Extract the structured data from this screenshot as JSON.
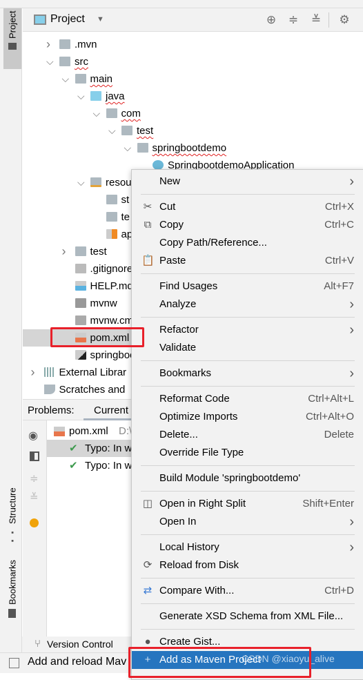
{
  "project_header": {
    "title": "Project",
    "icons": [
      "locate-icon",
      "expand-all-icon",
      "collapse-all-icon",
      "gear-icon"
    ]
  },
  "side_tabs": {
    "project": "Project",
    "structure": "Structure",
    "bookmarks": "Bookmarks"
  },
  "tree": [
    {
      "label": ".mvn",
      "indent": 0,
      "arrow": "right",
      "icon": "folder",
      "squiggle": false
    },
    {
      "label": "src",
      "indent": 0,
      "arrow": "down",
      "icon": "folder",
      "squiggle": true
    },
    {
      "label": "main",
      "indent": 1,
      "arrow": "down",
      "icon": "folder",
      "squiggle": true
    },
    {
      "label": "java",
      "indent": 2,
      "arrow": "down",
      "icon": "source-folder",
      "squiggle": true
    },
    {
      "label": "com",
      "indent": 3,
      "arrow": "down",
      "icon": "package",
      "squiggle": true
    },
    {
      "label": "test",
      "indent": 4,
      "arrow": "down",
      "icon": "package",
      "squiggle": true
    },
    {
      "label": "springbootdemo",
      "indent": 5,
      "arrow": "down",
      "icon": "package",
      "squiggle": true
    },
    {
      "label": "SpringbootdemoApplication",
      "indent": 6,
      "arrow": "",
      "icon": "spring-class",
      "squiggle": false
    },
    {
      "label": "resou",
      "indent": 2,
      "arrow": "down",
      "icon": "resources-folder",
      "squiggle": false
    },
    {
      "label": "st",
      "indent": 3,
      "arrow": "",
      "icon": "folder",
      "squiggle": false
    },
    {
      "label": "te",
      "indent": 3,
      "arrow": "",
      "icon": "folder",
      "squiggle": false
    },
    {
      "label": "ap",
      "indent": 3,
      "arrow": "",
      "icon": "properties-file",
      "squiggle": false
    },
    {
      "label": "test",
      "indent": 1,
      "arrow": "right",
      "icon": "folder",
      "squiggle": false
    },
    {
      "label": ".gitignore",
      "indent": 1,
      "arrow": "",
      "icon": "ignore-file",
      "squiggle": false
    },
    {
      "label": "HELP.md",
      "indent": 1,
      "arrow": "",
      "icon": "markdown-file",
      "squiggle": false
    },
    {
      "label": "mvnw",
      "indent": 1,
      "arrow": "",
      "icon": "shell-file",
      "squiggle": false
    },
    {
      "label": "mvnw.cmd",
      "indent": 1,
      "arrow": "",
      "icon": "text-file",
      "squiggle": false
    },
    {
      "label": "pom.xml",
      "indent": 1,
      "arrow": "",
      "icon": "xml-file",
      "squiggle": false,
      "selected": true
    },
    {
      "label": "springboot",
      "indent": 1,
      "arrow": "",
      "icon": "iml-file",
      "squiggle": false
    },
    {
      "label": "External Librar",
      "indent": -1,
      "arrow": "right",
      "icon": "libraries",
      "squiggle": false
    },
    {
      "label": "Scratches and",
      "indent": -1,
      "arrow": "",
      "icon": "scratches",
      "squiggle": false
    }
  ],
  "problems": {
    "label": "Problems:",
    "tab": "Current",
    "file": "pom.xml",
    "path": "D:\\",
    "items": [
      "Typo: In w",
      "Typo: In w"
    ]
  },
  "bottom": {
    "version_control": "Version Control",
    "status": "Add and reload Mav"
  },
  "menu": [
    {
      "label": "New",
      "submenu": true
    },
    {
      "sep": true
    },
    {
      "label": "Cut",
      "u": "t",
      "shortcut": "Ctrl+X",
      "icon": "scissors-icon",
      "glyph": "✂"
    },
    {
      "label": "Copy",
      "u": "C",
      "shortcut": "Ctrl+C",
      "icon": "copy-icon",
      "glyph": "⧉"
    },
    {
      "label": "Copy Path/Reference..."
    },
    {
      "label": "Paste",
      "u": "P",
      "shortcut": "Ctrl+V",
      "icon": "clipboard-icon",
      "glyph": "📋"
    },
    {
      "sep": true
    },
    {
      "label": "Find Usages",
      "u": "U",
      "shortcut": "Alt+F7"
    },
    {
      "label": "Analyze",
      "u": "z",
      "submenu": true
    },
    {
      "sep": true
    },
    {
      "label": "Refactor",
      "u": "R",
      "submenu": true
    },
    {
      "label": "Validate",
      "u": "V"
    },
    {
      "sep": true
    },
    {
      "label": "Bookmarks",
      "submenu": true
    },
    {
      "sep": true
    },
    {
      "label": "Reformat Code",
      "u": "R",
      "shortcut": "Ctrl+Alt+L"
    },
    {
      "label": "Optimize Imports",
      "u": "z",
      "shortcut": "Ctrl+Alt+O"
    },
    {
      "label": "Delete...",
      "u": "D",
      "shortcut": "Delete"
    },
    {
      "label": "Override File Type"
    },
    {
      "sep": true
    },
    {
      "label": "Build Module 'springbootdemo'",
      "u": "M"
    },
    {
      "sep": true
    },
    {
      "label": "Open in Right Split",
      "shortcut": "Shift+Enter",
      "icon": "split-icon",
      "glyph": "◫"
    },
    {
      "label": "Open In",
      "submenu": true
    },
    {
      "sep": true
    },
    {
      "label": "Local History",
      "u": "H",
      "submenu": true
    },
    {
      "label": "Reload from Disk",
      "icon": "reload-icon",
      "glyph": "⟳"
    },
    {
      "sep": true
    },
    {
      "label": "Compare With...",
      "shortcut": "Ctrl+D",
      "icon": "compare-icon",
      "glyph": "⇄"
    },
    {
      "sep": true
    },
    {
      "label": "Generate XSD Schema from XML File..."
    },
    {
      "sep": true
    },
    {
      "label": "Create Gist...",
      "icon": "github-icon",
      "glyph": "●"
    },
    {
      "label": "Add as Maven Project",
      "icon": "plus-icon",
      "glyph": "+",
      "selected": true
    }
  ],
  "watermark": "CSDN @xiaoyu_alive",
  "colors": {
    "selection": "#2675bf",
    "highlight_box": "#e8202a",
    "folder": "#aeb9c0",
    "source_folder": "#87cfea"
  }
}
